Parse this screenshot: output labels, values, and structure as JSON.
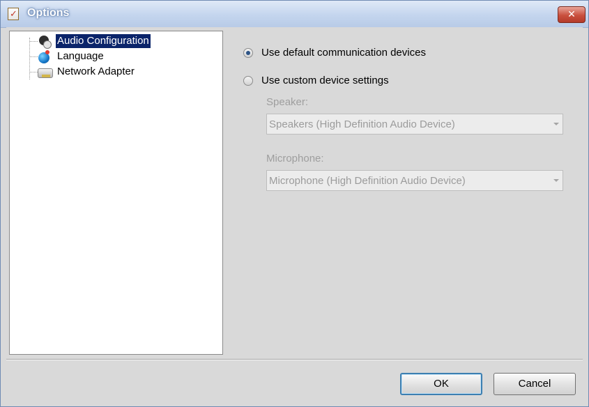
{
  "window": {
    "title": "Options",
    "close_label": "✕"
  },
  "tree": {
    "items": [
      {
        "label": "Audio Configuration",
        "icon": "audio-headset-icon",
        "selected": true
      },
      {
        "label": "Language",
        "icon": "globe-icon",
        "selected": false
      },
      {
        "label": "Network Adapter",
        "icon": "network-adapter-icon",
        "selected": false
      }
    ]
  },
  "audio": {
    "option_default": "Use default communication devices",
    "option_custom": "Use custom device settings",
    "selected_option": "default",
    "speaker_label": "Speaker:",
    "speaker_value": "Speakers (High Definition Audio Device)",
    "microphone_label": "Microphone:",
    "microphone_value": "Microphone (High Definition Audio Device)"
  },
  "buttons": {
    "ok": "OK",
    "cancel": "Cancel"
  },
  "colors": {
    "selection": "#0a246a",
    "disabled_text": "#9e9e9e",
    "dialog_bg": "#d9d9d9"
  }
}
